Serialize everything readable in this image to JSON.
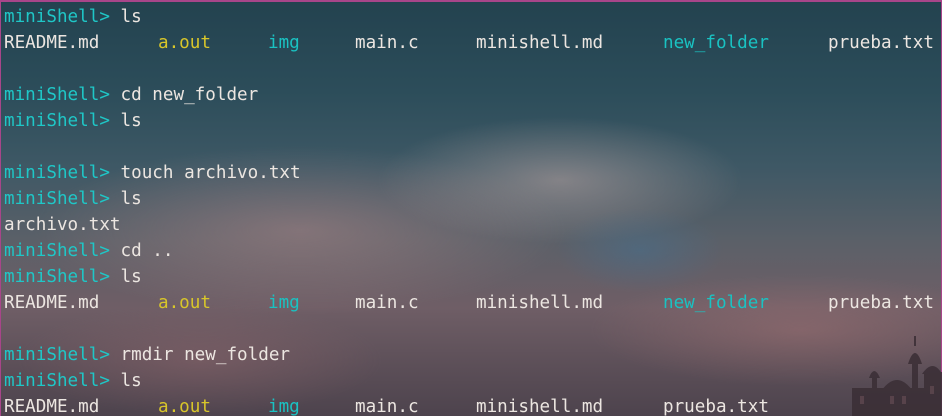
{
  "terminal": {
    "prompt": "miniShell>",
    "lines": [
      {
        "type": "cmd",
        "text": "ls"
      },
      {
        "type": "ls",
        "items": [
          {
            "name": "README.md",
            "kind": "file"
          },
          {
            "name": "a.out",
            "kind": "exec"
          },
          {
            "name": "img",
            "kind": "dir"
          },
          {
            "name": "main.c",
            "kind": "file"
          },
          {
            "name": "minishell.md",
            "kind": "file"
          },
          {
            "name": "new_folder",
            "kind": "dir"
          },
          {
            "name": "prueba.txt",
            "kind": "file"
          }
        ]
      },
      {
        "type": "blank"
      },
      {
        "type": "cmd",
        "text": "cd new_folder"
      },
      {
        "type": "cmd",
        "text": "ls"
      },
      {
        "type": "blank"
      },
      {
        "type": "cmd",
        "text": "touch archivo.txt"
      },
      {
        "type": "cmd",
        "text": "ls"
      },
      {
        "type": "out",
        "text": "archivo.txt"
      },
      {
        "type": "cmd",
        "text": "cd .."
      },
      {
        "type": "cmd",
        "text": "ls"
      },
      {
        "type": "ls",
        "items": [
          {
            "name": "README.md",
            "kind": "file"
          },
          {
            "name": "a.out",
            "kind": "exec"
          },
          {
            "name": "img",
            "kind": "dir"
          },
          {
            "name": "main.c",
            "kind": "file"
          },
          {
            "name": "minishell.md",
            "kind": "file"
          },
          {
            "name": "new_folder",
            "kind": "dir"
          },
          {
            "name": "prueba.txt",
            "kind": "file"
          }
        ]
      },
      {
        "type": "blank"
      },
      {
        "type": "cmd",
        "text": "rmdir new_folder"
      },
      {
        "type": "cmd",
        "text": "ls"
      },
      {
        "type": "ls",
        "items": [
          {
            "name": "README.md",
            "kind": "file"
          },
          {
            "name": "a.out",
            "kind": "exec"
          },
          {
            "name": "img",
            "kind": "dir"
          },
          {
            "name": "main.c",
            "kind": "file"
          },
          {
            "name": "minishell.md",
            "kind": "file"
          },
          {
            "name": "prueba.txt",
            "kind": "file"
          }
        ]
      }
    ]
  },
  "colors": {
    "prompt": "#1fc7c7",
    "text": "#ece6e1",
    "executable": "#d8c62a",
    "directory": "#1ac2c2",
    "window_border": "#a8458a"
  }
}
